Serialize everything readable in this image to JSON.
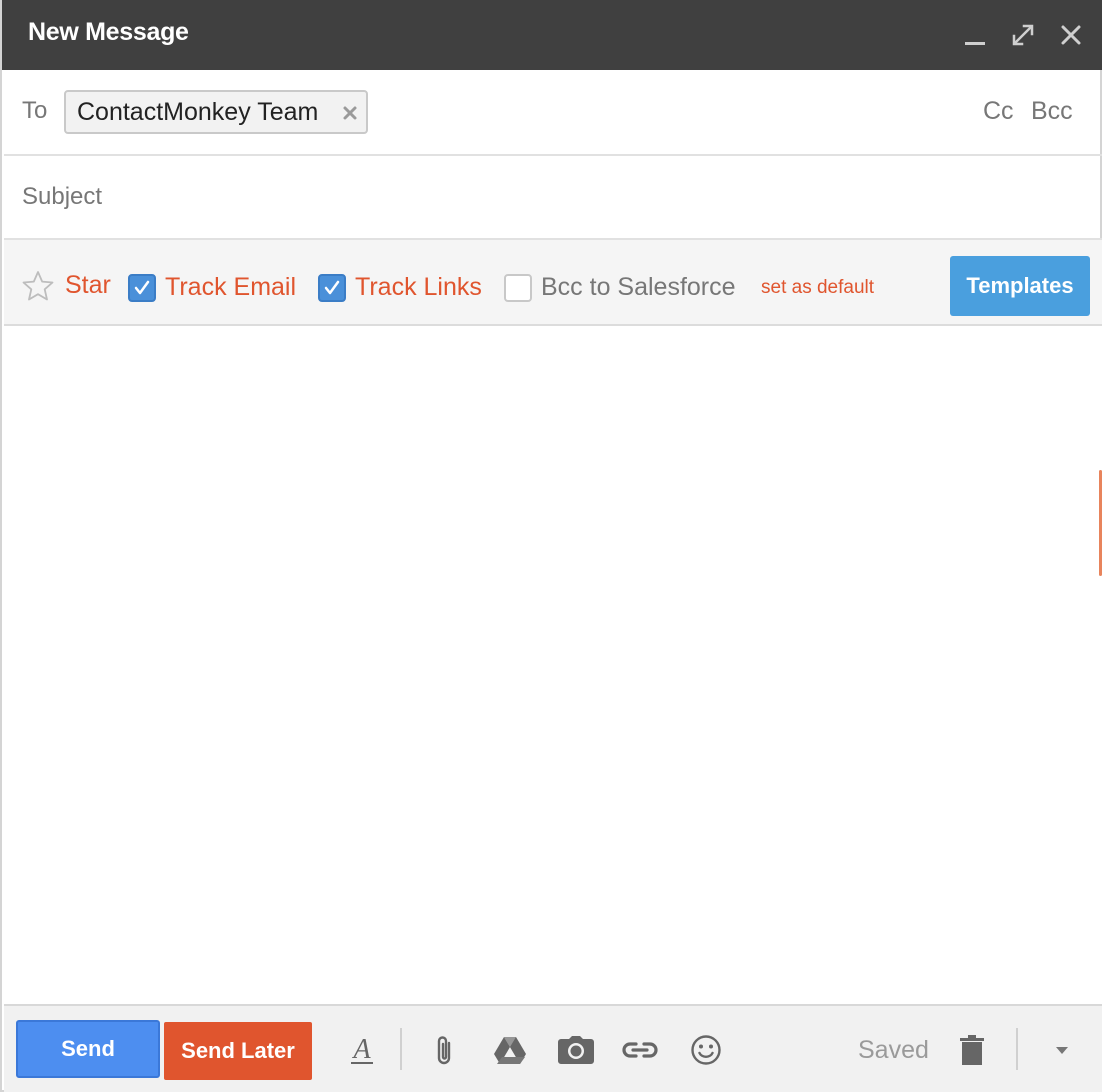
{
  "window": {
    "title": "New Message"
  },
  "recipients": {
    "to_label": "To",
    "chips": [
      {
        "name": "ContactMonkey Team"
      }
    ],
    "cc_label": "Cc",
    "bcc_label": "Bcc"
  },
  "subject": {
    "placeholder": "Subject",
    "value": ""
  },
  "options": {
    "star_label": "Star",
    "track_email": {
      "label": "Track Email",
      "checked": true
    },
    "track_links": {
      "label": "Track Links",
      "checked": true
    },
    "bcc_salesforce": {
      "label": "Bcc to Salesforce",
      "checked": false
    },
    "set_default_label": "set as default",
    "templates_label": "Templates"
  },
  "footer": {
    "send_label": "Send",
    "send_later_label": "Send Later",
    "status_text": "Saved",
    "icons": [
      "format-text-icon",
      "attachment-icon",
      "drive-icon",
      "camera-icon",
      "link-icon",
      "emoji-icon",
      "trash-icon",
      "more-options-icon"
    ]
  },
  "colors": {
    "titlebar": "#404040",
    "accent_orange": "#e0552e",
    "send_blue": "#4d8ef0",
    "templates_blue": "#4a9fde",
    "checkbox_blue": "#4a90d9"
  }
}
